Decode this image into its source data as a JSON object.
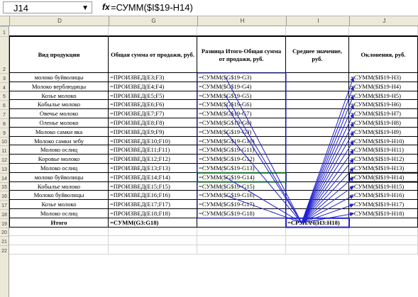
{
  "formula_bar": {
    "cell_ref": "J14",
    "fx": "fx",
    "formula": "=СУММ($I$19-H14)"
  },
  "columns": [
    "D",
    "G",
    "H",
    "I",
    "J"
  ],
  "rows": [
    "1",
    "2",
    "3",
    "4",
    "5",
    "6",
    "7",
    "8",
    "9",
    "10",
    "11",
    "12",
    "13",
    "14",
    "15",
    "16",
    "17",
    "18",
    "19",
    "20",
    "21",
    "22"
  ],
  "table": {
    "headers": [
      "Вид продукции",
      "Общая сумма от продажи, руб.",
      "Разница Итого-Общая сумма от продажи, руб.",
      "Среднее значение, руб.",
      "Оклонения, руб."
    ],
    "data_rows": [
      [
        "молоко буйволицы",
        "=ПРОИЗВЕД(E3;F3)",
        "=СУММ($G$19-G3)",
        "",
        "=СУММ($I$19-H3)"
      ],
      [
        "Молоко верблюдицы",
        "=ПРОИЗВЕД(E4;F4)",
        "=СУММ($G$19-G4)",
        "",
        "=СУММ($I$19-H4)"
      ],
      [
        "Козье молоко",
        "=ПРОИЗВЕД(E5;F5)",
        "=СУММ($G$19-G5)",
        "",
        "=СУММ($I$19-H5)"
      ],
      [
        "Кобылье молоко",
        "=ПРОИЗВЕД(E6;F6)",
        "=СУММ($G$19-G6)",
        "",
        "=СУММ($I$19-H6)"
      ],
      [
        "Овечье молоко",
        "=ПРОИЗВЕД(E7;F7)",
        "=СУММ($G$19-G7)",
        "",
        "=СУММ($I$19-H7)"
      ],
      [
        "Оленье молоко",
        "=ПРОИЗВЕД(E8;F8)",
        "=СУММ($G$19-G8)",
        "",
        "=СУММ($I$19-H8)"
      ],
      [
        "Молоко самки яка",
        "=ПРОИЗВЕД(E9;F9)",
        "=СУММ($G$19-G9)",
        "",
        "=СУММ($I$19-H9)"
      ],
      [
        "Молоко самки зебу",
        "=ПРОИЗВЕД(E10;F10)",
        "=СУММ($G$19-G10)",
        "",
        "=СУММ($I$19-H10)"
      ],
      [
        "Молоко ослиц",
        "=ПРОИЗВЕД(E11;F11)",
        "=СУММ($G$19-G11)",
        "",
        "=СУММ($I$19-H11)"
      ],
      [
        "Коровье молоко",
        "=ПРОИЗВЕД(E12;F12)",
        "=СУММ($G$19-G12)",
        "",
        "=СУММ($I$19-H12)"
      ],
      [
        "Молоко ослиц",
        "=ПРОИЗВЕД(E13;F13)",
        "=СУММ($G$19-G13)",
        "",
        "=СУММ($I$19-H13)"
      ],
      [
        "молоко буйволицы",
        "=ПРОИЗВЕД(E14;F14)",
        "=СУММ($G$19-G14)",
        "",
        "=СУММ($I$19-H14)"
      ],
      [
        "Кобылье молоко",
        "=ПРОИЗВЕД(E15;F15)",
        "=СУММ($G$19-G15)",
        "",
        "=СУММ($I$19-H15)"
      ],
      [
        "Молоко буйволицы",
        "=ПРОИЗВЕД(E16;F16)",
        "=СУММ($G$19-G16)",
        "",
        "=СУММ($I$19-H16)"
      ],
      [
        "Козье молоко",
        "=ПРОИЗВЕД(E17;F17)",
        "=СУММ($G$19-G17)",
        "",
        "=СУММ($I$19-H17)"
      ],
      [
        "Молоко ослиц",
        "=ПРОИЗВЕД(E18;F18)",
        "=СУММ($G$19-G18)",
        "",
        "=СУММ($I$19-H18)"
      ]
    ],
    "total_row": [
      "Итого",
      "=СУММ(G3:G18)",
      "",
      "=СРЗНАЧ(H3:H18)",
      ""
    ]
  },
  "colors": {
    "precedent_arrow": "#2222cc",
    "active_cell_border": "#000000",
    "selected_h14_border": "#1e6b2a",
    "grid_border": "#000000",
    "header_bg": "#ece9d8"
  }
}
